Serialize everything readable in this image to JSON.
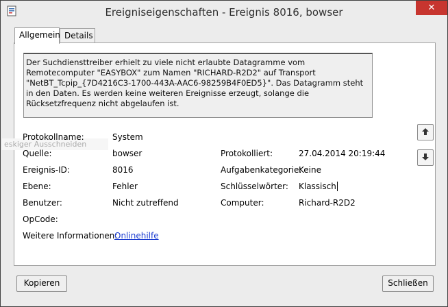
{
  "window": {
    "title": "Ereigniseigenschaften - Ereignis 8016, bowser",
    "close_glyph": "✕"
  },
  "tabs": [
    {
      "label": "Allgemein",
      "active": true
    },
    {
      "label": "Details",
      "active": false
    }
  ],
  "description": "Der Suchdiensttreiber erhielt zu viele nicht erlaubte Datagramme vom Remotecomputer \"EASYBOX\" zum Namen \"RICHARD-R2D2\" auf Transport \"NetBT_Tcpip_{7D4216C3-1700-443A-AAC6-98259B4F0ED5}\". Das Datagramm steht in den Daten. Es werden keine weiteren Ereignisse erzeugt, solange die Rücksetzfrequenz nicht abgelaufen ist.",
  "ghost_text": "eskiger Ausschneiden",
  "fields": {
    "protokollname": {
      "label": "Protokollname:",
      "value": "System"
    },
    "quelle": {
      "label": "Quelle:",
      "value": "bowser"
    },
    "protokolliert": {
      "label": "Protokolliert:",
      "value": "27.04.2014 20:19:44"
    },
    "ereignis_id": {
      "label": "Ereignis-ID:",
      "value": "8016"
    },
    "aufgabenkategorie": {
      "label": "Aufgabenkategorie:",
      "value": "Keine"
    },
    "ebene": {
      "label": "Ebene:",
      "value": "Fehler"
    },
    "schluesselwoerter": {
      "label": "Schlüsselwörter:",
      "value": "Klassisch"
    },
    "benutzer": {
      "label": "Benutzer:",
      "value": "Nicht zutreffend"
    },
    "computer": {
      "label": "Computer:",
      "value": "Richard-R2D2"
    },
    "opcode": {
      "label": "OpCode:",
      "value": ""
    },
    "weitere": {
      "label": "Weitere Informationen:",
      "value": "Onlinehilfe"
    }
  },
  "buttons": {
    "copy": "Kopieren",
    "close": "Schließen"
  },
  "colors": {
    "close_button": "#c7352f",
    "link": "#1a3bd0"
  }
}
